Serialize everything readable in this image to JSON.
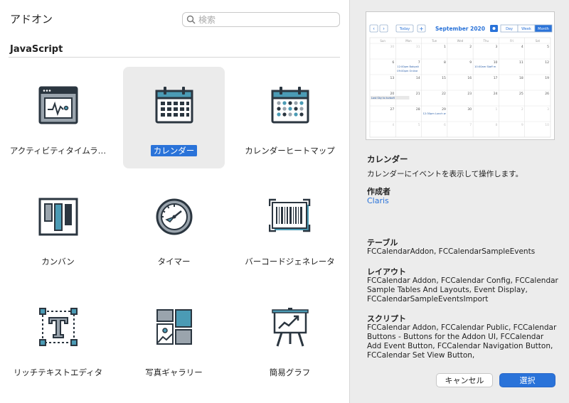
{
  "header": {
    "title": "アドオン",
    "search_placeholder": "検索"
  },
  "section": {
    "label": "JavaScript"
  },
  "addons": [
    {
      "label": "アクティビティタイムラ…",
      "icon": "activity-timeline-icon"
    },
    {
      "label": "カレンダー",
      "icon": "calendar-icon",
      "selected": true
    },
    {
      "label": "カレンダーヒートマップ",
      "icon": "calendar-heatmap-icon"
    },
    {
      "label": "カンバン",
      "icon": "kanban-icon"
    },
    {
      "label": "タイマー",
      "icon": "timer-icon"
    },
    {
      "label": "バーコードジェネレータ",
      "icon": "barcode-icon"
    },
    {
      "label": "リッチテキストエディタ",
      "icon": "rich-text-icon"
    },
    {
      "label": "写真ギャラリー",
      "icon": "photo-gallery-icon"
    },
    {
      "label": "簡易グラフ",
      "icon": "simple-chart-icon"
    }
  ],
  "preview": {
    "month": "September 2020",
    "today": "Today",
    "views": [
      "Day",
      "Week",
      "Month"
    ],
    "weekdays": [
      "Sun",
      "Mon",
      "Tue",
      "Wed",
      "Thu",
      "Fri",
      "Sat"
    ],
    "weeks": [
      [
        "30",
        "31",
        "1",
        "2",
        "3",
        "4",
        "5"
      ],
      [
        "6",
        "7",
        "8",
        "9",
        "10",
        "11",
        "12"
      ],
      [
        "13",
        "14",
        "15",
        "16",
        "17",
        "18",
        "19"
      ],
      [
        "20",
        "21",
        "22",
        "23",
        "24",
        "25",
        "26"
      ],
      [
        "27",
        "28",
        "29",
        "30",
        "1",
        "2",
        "3"
      ],
      [
        "4",
        "5",
        "6",
        "7",
        "8",
        "9",
        "10"
      ]
    ],
    "events": [
      {
        "text": "12:00pm Babysit"
      },
      {
        "text": "09:00pm Online"
      },
      {
        "text": "10:00am Staff m"
      },
      {
        "text": "Lost Sky to turbofi"
      },
      {
        "text": "12:30pm Lunch w"
      }
    ]
  },
  "details": {
    "name": "カレンダー",
    "description": "カレンダーにイベントを表示して操作します。",
    "author_label": "作成者",
    "author": "Claris",
    "tables_label": "テーブル",
    "tables": "FCCalendarAddon, FCCalendarSampleEvents",
    "layouts_label": "レイアウト",
    "layouts": "FCCalendar Addon, FCCalendar Config, FCCalendar Sample Tables And Layouts, Event Display, FCCalendarSampleEventsImport",
    "scripts_label": "スクリプト",
    "scripts": "FCCalendar Addon, FCCalendar Public, FCCalendar Buttons - Buttons for the Addon UI, FCCalendar Add Event Button, FCCalendar Navigation Button, FCCalendar Set View Button,"
  },
  "buttons": {
    "cancel": "キャンセル",
    "select": "選択"
  },
  "colors": {
    "accent": "#2a73d9",
    "icon_dark": "#2b3640",
    "icon_teal": "#4b9bb5",
    "icon_gray": "#9aa4ad"
  }
}
